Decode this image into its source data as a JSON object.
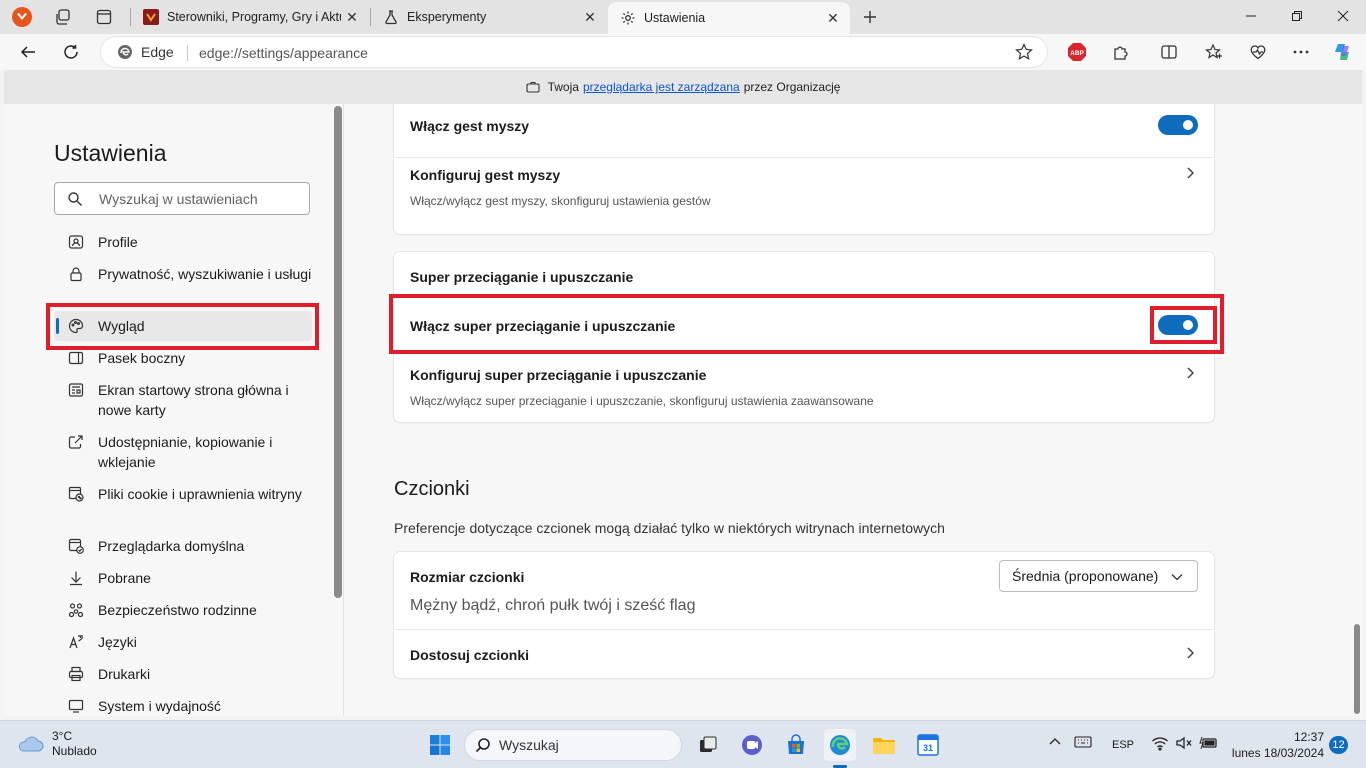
{
  "browser": {
    "tabs": [
      {
        "label": "Sterowniki, Programy, Gry i Aktua",
        "icon": "site-logo-icon"
      },
      {
        "label": "Eksperymenty",
        "icon": "flask-icon"
      },
      {
        "label": "Ustawienia",
        "icon": "gear-icon",
        "active": true
      }
    ],
    "omnibox": {
      "site_label": "Edge",
      "url": "edge://settings/appearance"
    },
    "banner": {
      "prefix": "Twoja",
      "link": "przeglądarka jest zarządzana",
      "suffix": "przez Organizację"
    }
  },
  "sidebar": {
    "title": "Ustawienia",
    "search_placeholder": "Wyszukaj w ustawieniach",
    "items": [
      {
        "label": "Profile",
        "icon": "profile-icon"
      },
      {
        "label": "Prywatność, wyszukiwanie i usługi",
        "icon": "lock-icon"
      },
      {
        "label": "Wygląd",
        "icon": "palette-icon",
        "selected": true
      },
      {
        "label": "Pasek boczny",
        "icon": "sidebar-icon"
      },
      {
        "label": "Ekran startowy strona główna i nowe karty",
        "icon": "home-icon"
      },
      {
        "label": "Udostępnianie, kopiowanie i wklejanie",
        "icon": "share-icon"
      },
      {
        "label": "Pliki cookie i uprawnienia witryny",
        "icon": "cookie-icon"
      },
      {
        "label": "Przeglądarka domyślna",
        "icon": "browser-icon"
      },
      {
        "label": "Pobrane",
        "icon": "download-icon"
      },
      {
        "label": "Bezpieczeństwo rodzinne",
        "icon": "family-icon"
      },
      {
        "label": "Języki",
        "icon": "language-icon"
      },
      {
        "label": "Drukarki",
        "icon": "printer-icon"
      },
      {
        "label": "System i wydajność",
        "icon": "system-icon"
      }
    ]
  },
  "main": {
    "mouse_card": {
      "toggle_label": "Włącz gest myszy",
      "toggle_on": true,
      "config_label": "Konfiguruj gest myszy",
      "config_desc": "Włącz/wyłącz gest myszy, skonfiguruj ustawienia gestów"
    },
    "drag_card": {
      "header": "Super przeciąganie i upuszczanie",
      "toggle_label": "Włącz super przeciąganie i upuszczanie",
      "toggle_on": true,
      "config_label": "Konfiguruj super przeciąganie i upuszczanie",
      "config_desc": "Włącz/wyłącz super przeciąganie i upuszczanie, skonfiguruj ustawienia zaawansowane"
    },
    "fonts": {
      "heading": "Czcionki",
      "description": "Preferencje dotyczące czcionek mogą działać tylko w niektórych witrynach internetowych",
      "size_label": "Rozmiar czcionki",
      "size_value": "Średnia (proponowane)",
      "sample_text": "Mężny bądź, chroń pułk twój i sześć flag",
      "customize_label": "Dostosuj czcionki"
    }
  },
  "taskbar": {
    "weather_temp": "3°C",
    "weather_desc": "Nublado",
    "search_label": "Wyszukaj",
    "lang": "ESP",
    "time": "12:37",
    "date": "lunes 18/03/2024",
    "notifications": "12"
  },
  "colors": {
    "accent": "#0f6cbd",
    "highlight": "#e01d2a"
  }
}
